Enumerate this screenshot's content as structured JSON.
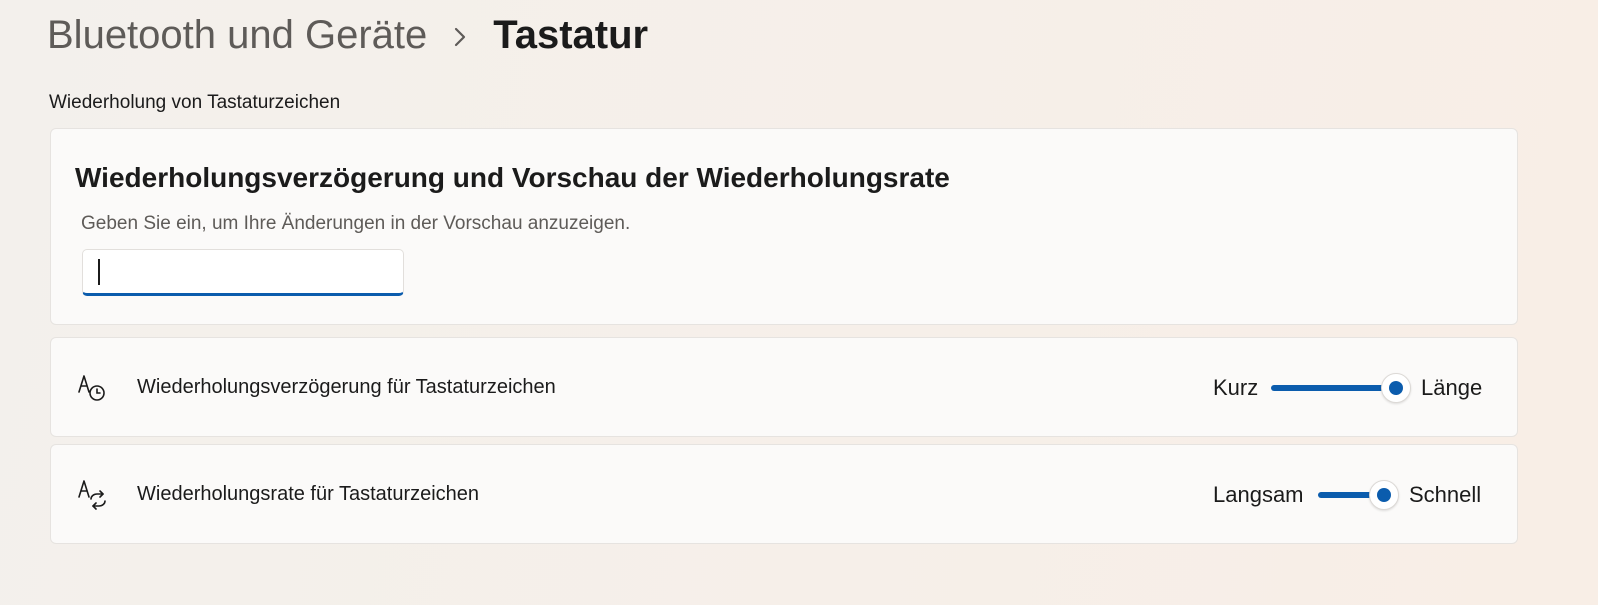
{
  "breadcrumb": {
    "parent": "Bluetooth und Geräte",
    "current": "Tastatur",
    "separator_icon": "chevron-right-icon"
  },
  "section": {
    "title": "Wiederholung von Tastaturzeichen"
  },
  "preview": {
    "heading": "Wiederholungsverzögerung und Vorschau der Wiederholungsrate",
    "hint": "Geben Sie ein, um Ihre Änderungen in der Vorschau anzuzeigen.",
    "input_value": ""
  },
  "settings": [
    {
      "icon": "text-clock-icon",
      "label": "Wiederholungsverzögerung für Tastaturzeichen",
      "slider": {
        "min_label": "Kurz",
        "max_label": "Länge",
        "value_fraction": 1.0
      }
    },
    {
      "icon": "text-repeat-icon",
      "label": "Wiederholungsrate für Tastaturzeichen",
      "slider": {
        "min_label": "Langsam",
        "max_label": "Schnell",
        "value_fraction": 1.0
      }
    }
  ],
  "colors": {
    "accent": "#0b5cad",
    "text_primary": "#1b1b1b",
    "text_secondary": "#5e5b58",
    "card_background": "#fbfaf9"
  }
}
